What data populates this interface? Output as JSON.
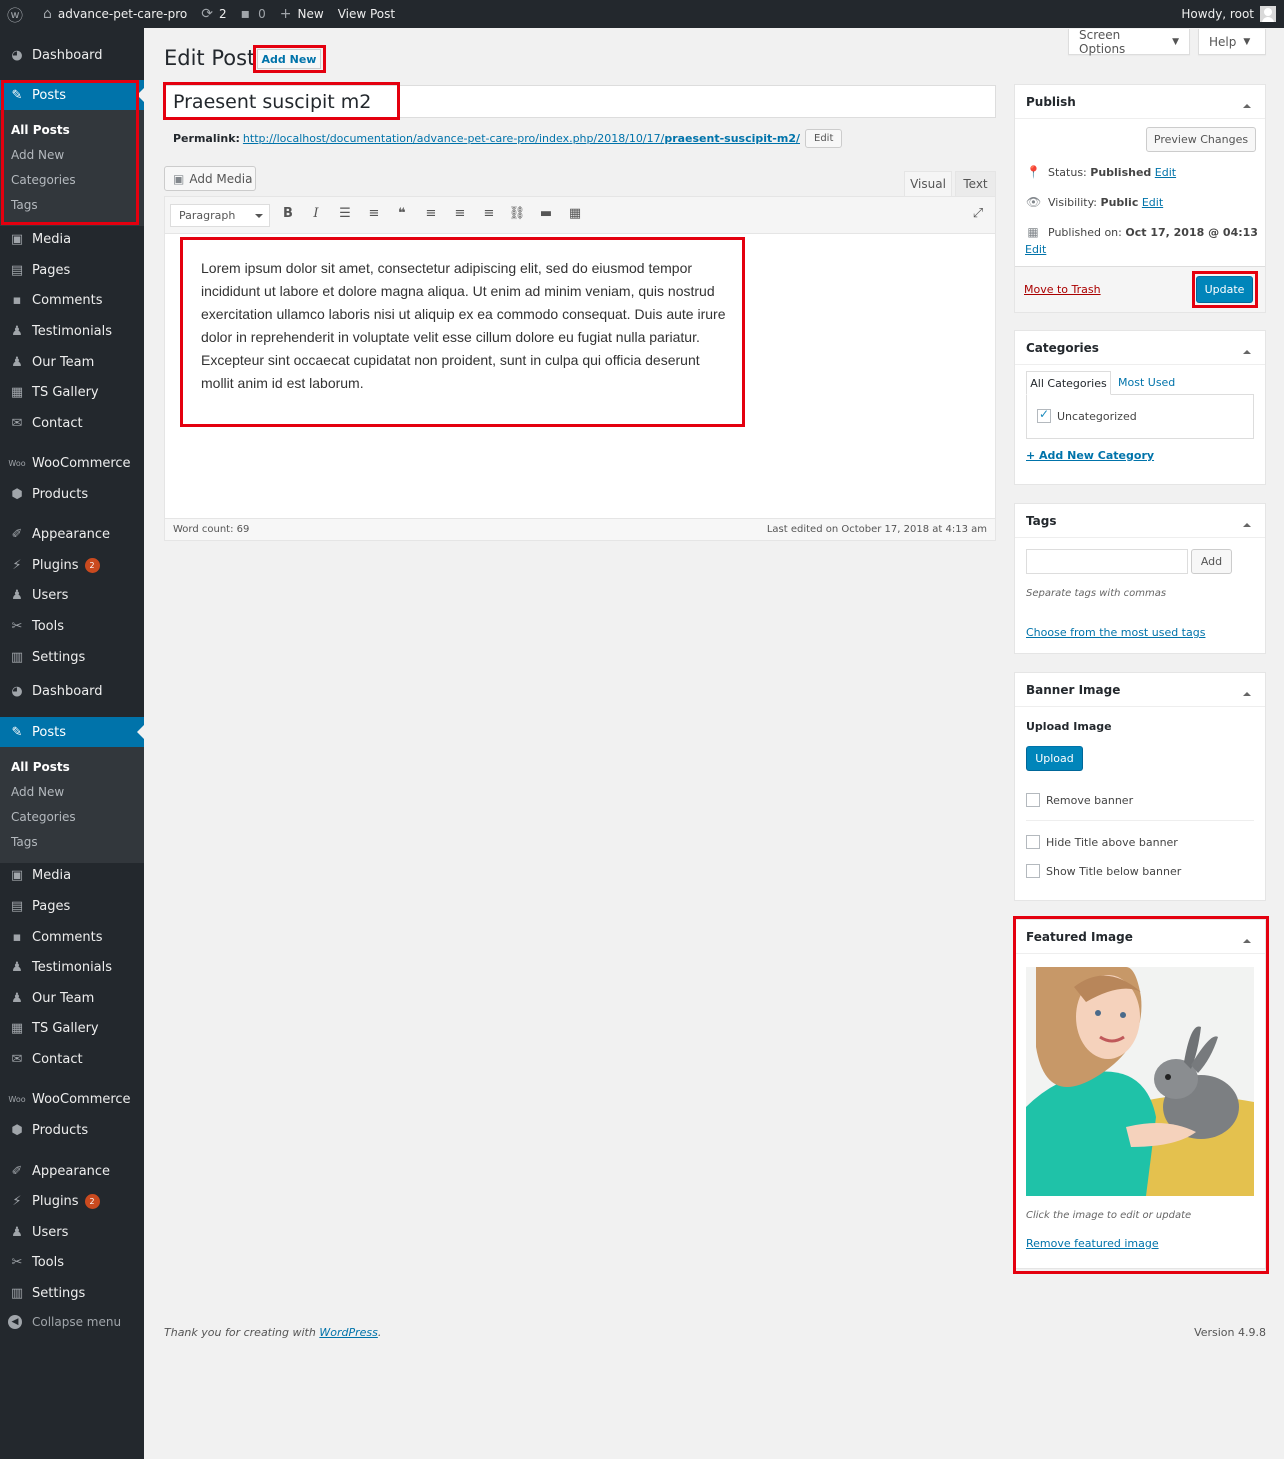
{
  "admin_bar": {
    "site_name": "advance-pet-care-pro",
    "updates_count": "2",
    "comments_count": "0",
    "new_label": "New",
    "view_post": "View Post",
    "howdy": "Howdy, root"
  },
  "sidebar": {
    "group1": {
      "dashboard": "Dashboard",
      "posts": "Posts",
      "sub": [
        "All Posts",
        "Add New",
        "Categories",
        "Tags"
      ],
      "media": "Media",
      "pages": "Pages",
      "comments": "Comments",
      "testimonials": "Testimonials",
      "our_team": "Our Team",
      "ts_gallery": "TS Gallery",
      "contact": "Contact",
      "woocommerce": "WooCommerce",
      "products": "Products",
      "appearance": "Appearance",
      "plugins": "Plugins",
      "plugins_badge": "2",
      "users": "Users",
      "tools": "Tools",
      "settings": "Settings"
    },
    "group2": {
      "dashboard": "Dashboard",
      "posts": "Posts",
      "sub": [
        "All Posts",
        "Add New",
        "Categories",
        "Tags"
      ],
      "media": "Media",
      "pages": "Pages",
      "comments": "Comments",
      "testimonials": "Testimonials",
      "our_team": "Our Team",
      "ts_gallery": "TS Gallery",
      "contact": "Contact",
      "woocommerce": "WooCommerce",
      "products": "Products",
      "appearance": "Appearance",
      "plugins": "Plugins",
      "plugins_badge": "2",
      "users": "Users",
      "tools": "Tools",
      "settings": "Settings"
    },
    "collapse": "Collapse menu"
  },
  "top_buttons": {
    "screen_options": "Screen Options",
    "help": "Help"
  },
  "page": {
    "title": "Edit Post",
    "add_new": "Add New",
    "post_title": "Praesent suscipit m2",
    "permalink_label": "Permalink:",
    "permalink_base": "http://localhost/documentation/advance-pet-care-pro/index.php/2018/10/17/",
    "permalink_slug": "praesent-suscipit-m2/",
    "permalink_edit": "Edit"
  },
  "editor": {
    "add_media": "Add Media",
    "tab_visual": "Visual",
    "tab_text": "Text",
    "format": "Paragraph",
    "content": "Lorem ipsum dolor sit amet, consectetur adipiscing elit, sed do eiusmod tempor incididunt ut labore et dolore magna aliqua. Ut enim ad minim veniam, quis nostrud exercitation ullamco laboris nisi ut aliquip ex ea commodo consequat. Duis aute irure dolor in reprehenderit in voluptate velit esse cillum dolore eu fugiat nulla pariatur. Excepteur sint occaecat cupidatat non proident, sunt in culpa qui officia deserunt mollit anim id est laborum.",
    "word_count": "Word count: 69",
    "last_edited": "Last edited on October 17, 2018 at 4:13 am"
  },
  "publish": {
    "title": "Publish",
    "preview": "Preview Changes",
    "status_label": "Status:",
    "status_value": "Published",
    "visibility_label": "Visibility:",
    "visibility_value": "Public",
    "published_label": "Published on:",
    "published_value": "Oct 17, 2018 @ 04:13",
    "edit": "Edit",
    "trash": "Move to Trash",
    "update": "Update"
  },
  "categories": {
    "title": "Categories",
    "tab_all": "All Categories",
    "tab_most": "Most Used",
    "item": "Uncategorized",
    "add_new": "+ Add New Category"
  },
  "tags": {
    "title": "Tags",
    "add": "Add",
    "hint": "Separate tags with commas",
    "choose": "Choose from the most used tags"
  },
  "banner": {
    "title": "Banner Image",
    "upload_label": "Upload Image",
    "upload_btn": "Upload",
    "remove": "Remove banner",
    "hide_title": "Hide Title above banner",
    "show_title": "Show Title below banner"
  },
  "featured": {
    "title": "Featured Image",
    "hint": "Click the image to edit or update",
    "remove": "Remove featured image"
  },
  "footer": {
    "thanks": "Thank you for creating with ",
    "wp_link": "WordPress",
    "period": ".",
    "version": "Version 4.9.8"
  }
}
